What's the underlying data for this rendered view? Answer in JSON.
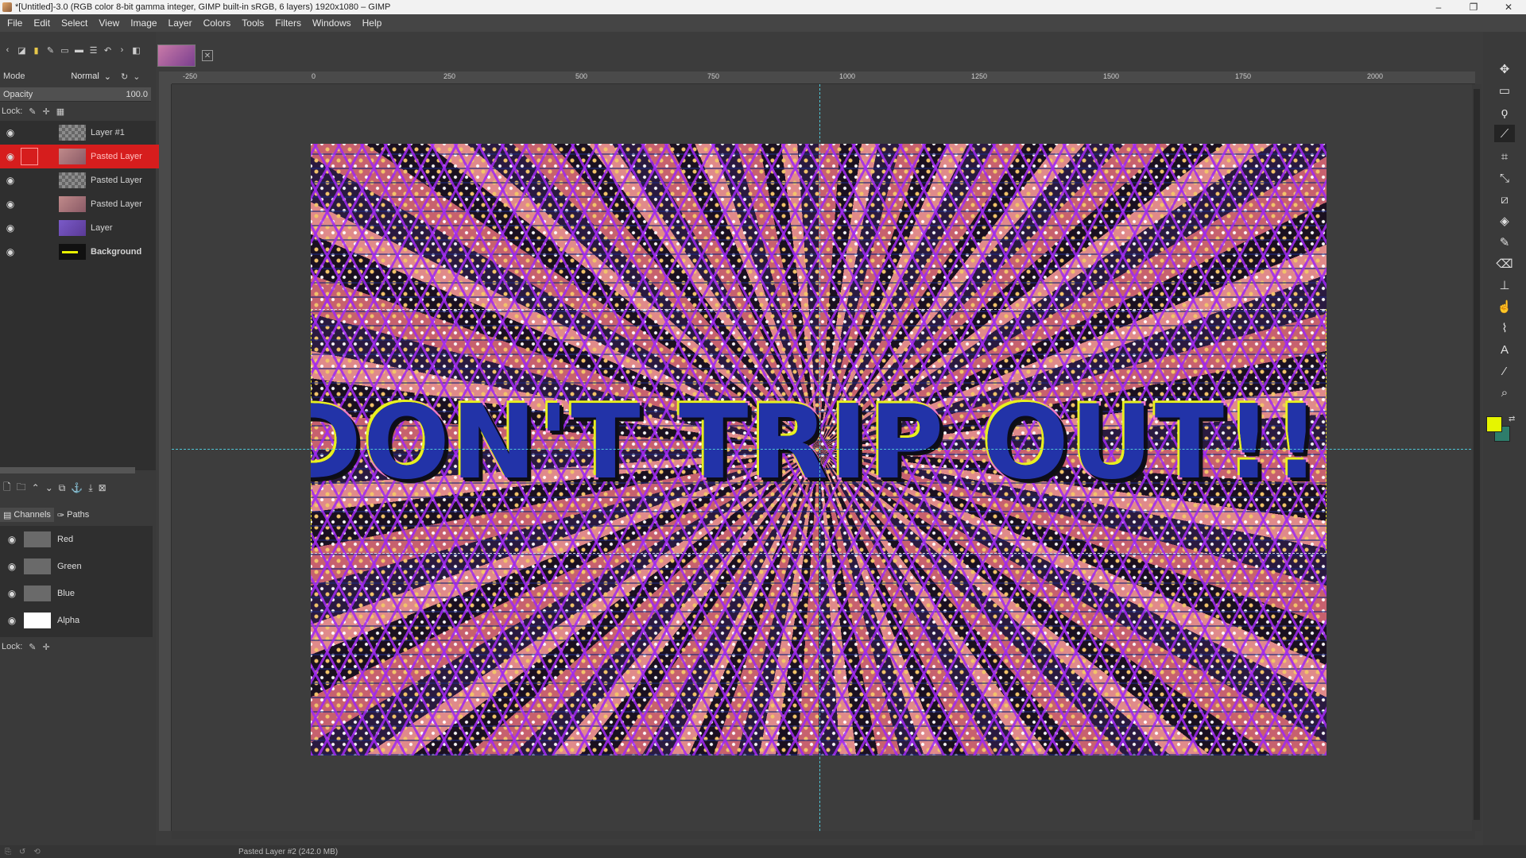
{
  "window": {
    "title": "*[Untitled]-3.0 (RGB color 8-bit gamma integer, GIMP built-in sRGB, 6 layers) 1920x1080 – GIMP",
    "minimize": "–",
    "maximize": "❐",
    "close": "✕"
  },
  "menubar": [
    "File",
    "Edit",
    "Select",
    "View",
    "Image",
    "Layer",
    "Colors",
    "Tools",
    "Filters",
    "Windows",
    "Help"
  ],
  "layers_panel": {
    "mode_label": "Mode",
    "mode_value": "Normal",
    "opacity_label": "Opacity",
    "opacity_value": "100.0",
    "lock_label": "Lock:",
    "layers": [
      {
        "name": "Layer #1",
        "visible": true,
        "selected": false,
        "thumb": "checker"
      },
      {
        "name": "Pasted Layer",
        "visible": true,
        "selected": true,
        "thumb": "pink"
      },
      {
        "name": "Pasted Layer",
        "visible": true,
        "selected": false,
        "thumb": "checker"
      },
      {
        "name": "Pasted Layer",
        "visible": true,
        "selected": false,
        "thumb": "pink"
      },
      {
        "name": "Layer",
        "visible": true,
        "selected": false,
        "thumb": "purple"
      },
      {
        "name": "Background",
        "visible": true,
        "selected": false,
        "thumb": "bg"
      }
    ]
  },
  "channels_panel": {
    "tab_channels": "Channels",
    "tab_paths": "Paths",
    "lock_label": "Lock:",
    "channels": [
      {
        "name": "Red"
      },
      {
        "name": "Green"
      },
      {
        "name": "Blue"
      },
      {
        "name": "Alpha"
      }
    ]
  },
  "ruler": {
    "h_labels": [
      "-250",
      "0",
      "250",
      "500",
      "750",
      "1000",
      "1250",
      "1500",
      "1750",
      "2000"
    ]
  },
  "canvas": {
    "headline": "DON'T TRIP OUT!!!"
  },
  "colors": {
    "foreground": "#e6f500",
    "background": "#2e7d6b",
    "selected_layer": "#d61d1d"
  },
  "statusbar": {
    "text": "Pasted Layer #2 (242.0 MB)"
  }
}
